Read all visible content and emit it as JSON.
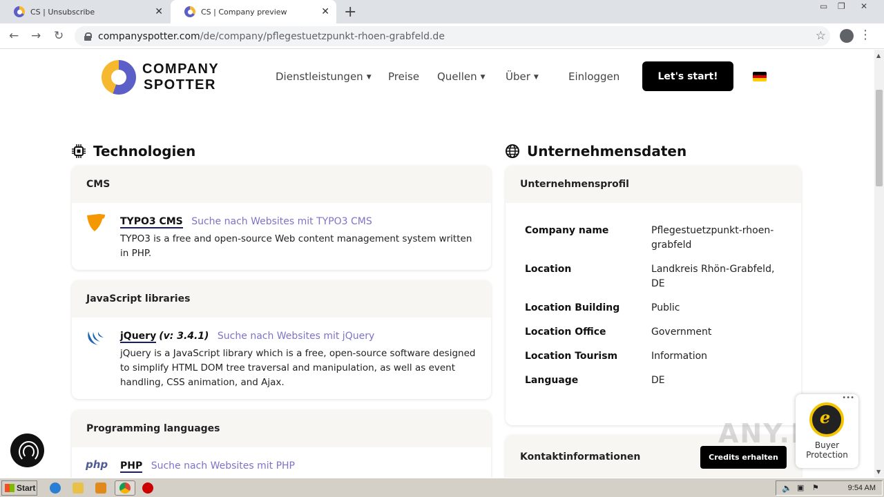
{
  "browser": {
    "tabs": [
      {
        "title": "CS | Unsubscribe",
        "active": false
      },
      {
        "title": "CS | Company preview",
        "active": true
      }
    ],
    "url_domain": "companyspotter.com",
    "url_path": "/de/company/pflegestuetzpunkt-rhoen-grabfeld.de"
  },
  "header": {
    "logo_line1": "COMPANY",
    "logo_line2": "SPOTTER",
    "nav": [
      {
        "label": "Dienstleistungen",
        "dropdown": true
      },
      {
        "label": "Preise",
        "dropdown": false
      },
      {
        "label": "Quellen",
        "dropdown": true
      },
      {
        "label": "Über",
        "dropdown": true
      }
    ],
    "login": "Einloggen",
    "cta": "Let's start!"
  },
  "technologies": {
    "title": "Technologien",
    "cards": [
      {
        "category": "CMS",
        "items": [
          {
            "name": "TYPO3 CMS",
            "version": "",
            "link": "Suche nach Websites mit TYPO3 CMS",
            "desc": "TYPO3 is a free and open-source Web content management system written in PHP.",
            "icon": "typo3-icon"
          }
        ]
      },
      {
        "category": "JavaScript libraries",
        "items": [
          {
            "name": "jQuery",
            "version": "(v: 3.4.1)",
            "link": "Suche nach Websites mit jQuery",
            "desc": "jQuery is a JavaScript library which is a free, open-source software designed to simplify HTML DOM tree traversal and manipulation, as well as event handling, CSS animation, and Ajax.",
            "icon": "jquery-icon"
          }
        ]
      },
      {
        "category": "Programming languages",
        "items": [
          {
            "name": "PHP",
            "version": "",
            "link": "Suche nach Websites mit PHP",
            "desc": "",
            "icon": "php-icon"
          }
        ]
      }
    ]
  },
  "company": {
    "title": "Unternehmensdaten",
    "profile_heading": "Unternehmensprofil",
    "facts": [
      {
        "key": "Company name",
        "value": "Pflegestuetzpunkt-rhoen-grabfeld"
      },
      {
        "key": "Location",
        "value": "Landkreis Rhön-Grabfeld, DE"
      },
      {
        "key": "Location Building",
        "value": "Public"
      },
      {
        "key": "Location Office",
        "value": "Government"
      },
      {
        "key": "Location Tourism",
        "value": "Information"
      },
      {
        "key": "Language",
        "value": "DE"
      }
    ],
    "contact_heading": "Kontaktinformationen",
    "credits_button": "Credits erhalten"
  },
  "trusted_shops": {
    "line1": "Buyer",
    "line2": "Protection"
  },
  "watermark": "ANY.RUN",
  "taskbar": {
    "start": "Start",
    "clock": "9:54 AM"
  },
  "colors": {
    "accent_link": "#7d73c9",
    "brand_blue": "#5b5fc7",
    "brand_yellow": "#f5b82e",
    "cta_bg": "#000000"
  }
}
